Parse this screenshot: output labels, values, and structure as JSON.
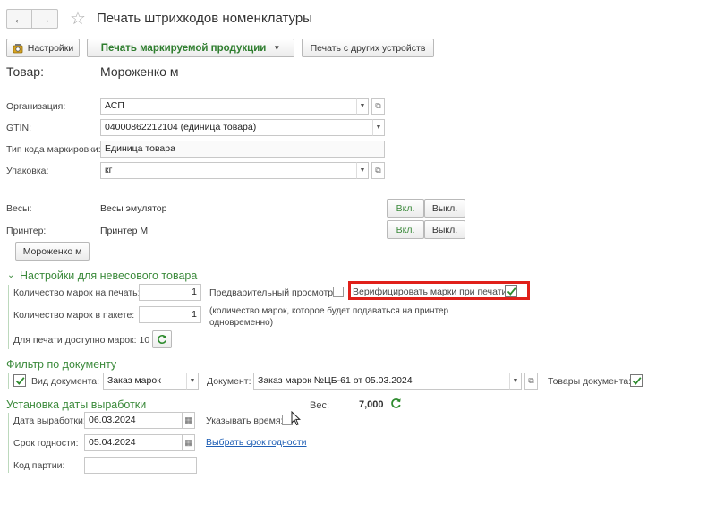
{
  "window": {
    "title": "Печать штрихкодов номенклатуры",
    "back_glyph": "←",
    "forward_glyph": "→",
    "star_glyph": "☆"
  },
  "toolbar": {
    "settings_label": "Настройки",
    "print_marked_label": "Печать маркируемой продукции",
    "print_other_label": "Печать с других устройств"
  },
  "product": {
    "label": "Товар:",
    "value": "Мороженко м"
  },
  "form": {
    "org_label": "Организация:",
    "org_value": "АСП",
    "gtin_label": "GTIN:",
    "gtin_value": "04000862212104 (единица товара)",
    "code_type_label": "Тип кода маркировки:",
    "code_type_value": "Единица товара",
    "pack_label": "Упаковка:",
    "pack_value": "кг"
  },
  "devices": {
    "scales_label": "Весы:",
    "scales_value": "Весы эмулятор",
    "printer_label": "Принтер:",
    "printer_value": "Принтер М",
    "on_label": "Вкл.",
    "off_label": "Выкл.",
    "product_button_label": "Мороженко м"
  },
  "nonweight": {
    "section_title": "Настройки для невесового товара",
    "marks_to_print_label": "Количество марок на печать:",
    "marks_to_print_value": "1",
    "preview_label": "Предварительный просмотр:",
    "preview_checked": false,
    "verify_label": "Верифицировать марки при печати:",
    "verify_checked": true,
    "marks_in_pack_label": "Количество марок в пакете:",
    "marks_in_pack_value": "1",
    "pack_note": "(количество марок, которое будет подаваться на принтер одновременно)",
    "available_label": "Для печати доступно марок: 10"
  },
  "doc_filter": {
    "section_title": "Фильтр по документу",
    "doc_type_label": "Вид документа:",
    "doc_type_checked": true,
    "doc_type_value": "Заказ марок",
    "doc_label": "Документ:",
    "doc_value": "Заказ марок №ЦБ-61 от 05.03.2024",
    "doc_goods_label": "Товары документа:",
    "doc_goods_checked": true
  },
  "production": {
    "section_title": "Установка даты выработки",
    "weight_label": "Вес:",
    "weight_value": "7,000",
    "prod_date_label": "Дата выработки:",
    "prod_date_value": "06.03.2024",
    "show_time_label": "Указывать время:",
    "show_time_checked": false,
    "expiry_label": "Срок годности:",
    "expiry_value": "05.04.2024",
    "choose_expiry_link": "Выбрать срок годности",
    "batch_label": "Код партии:",
    "batch_value": ""
  },
  "colors": {
    "accent_green": "#3b8a3b",
    "highlight_red": "#e0201a"
  }
}
